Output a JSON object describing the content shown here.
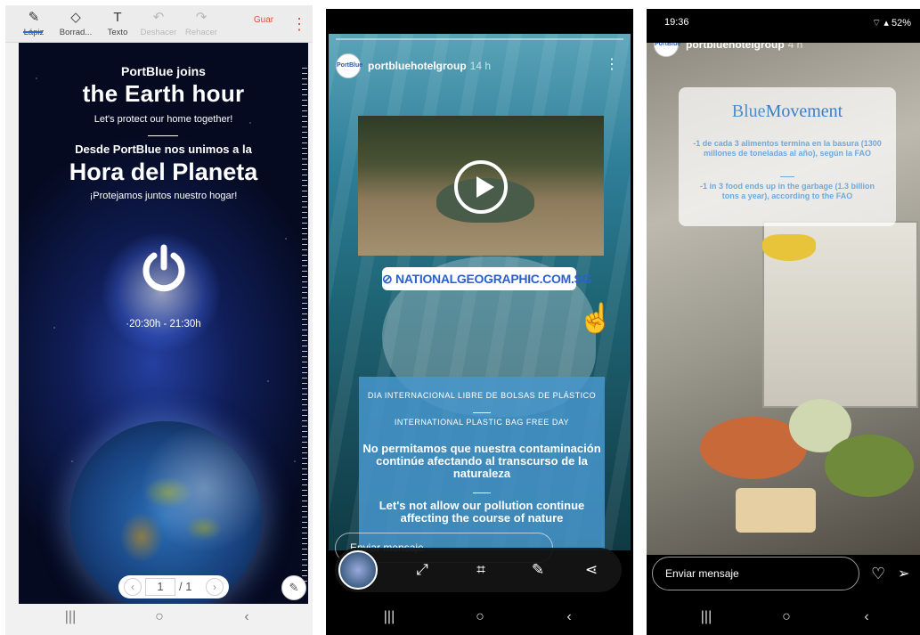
{
  "panel1": {
    "toolbar": {
      "pen_label": "Lápiz",
      "eraser_label": "Borrad...",
      "text_label": "Texto",
      "undo_label": "Deshacer",
      "redo_label": "Rehacer",
      "save_label": "Guar"
    },
    "poster": {
      "line1": "PortBlue joins",
      "line2": "the Earth hour",
      "line3": "Let's protect our home together!",
      "line4": "Desde PortBlue nos unimos a la",
      "line5": "Hora del Planeta",
      "line6": "¡Protejamos juntos nuestro hogar!",
      "time": "·20:30h - 21:30h"
    },
    "pager": {
      "current": "1",
      "total": "/ 1"
    }
  },
  "panel2": {
    "username": "portbluehotelgroup",
    "time_ago": "14 h",
    "avatar_text": "PortBlue",
    "link_text": "NATIONALGEOGRAPHIC.COM.SG",
    "info_es_title": "DIA INTERNACIONAL LIBRE DE BOLSAS DE PLÁSTICO",
    "info_en_title": "INTERNATIONAL PLASTIC BAG FREE DAY",
    "info_es_body": "No permitamos que nuestra contaminación continúe afectando al transcurso de la naturaleza",
    "info_en_body": "Let's not allow our pollution continue affecting the course of nature",
    "message_placeholder": "Enviar mensaje"
  },
  "panel3": {
    "status_time": "19:36",
    "status_battery": "52%",
    "username": "portbluehotelgroup",
    "time_ago": "4 h",
    "avatar_text": "PortBlue",
    "title_part1": "Blue",
    "title_part2": "Movement",
    "text_es": "-1 de cada 3 alimentos termina en la basura (1300 millones de toneladas al año), según la FAO",
    "text_en": "-1 in 3 food ends up in the garbage (1.3 billion tons a year), according to the FAO",
    "message_placeholder": "Enviar mensaje"
  },
  "icons": {
    "pen": "pencil-icon",
    "eraser": "eraser-icon",
    "text": "text-icon",
    "undo": "undo-icon",
    "redo": "redo-icon",
    "power": "power-icon",
    "link": "link-icon"
  },
  "colors": {
    "accent_red": "#e0503c",
    "instagram_link": "#2b5fd0",
    "blue_movement": "#4a8fd0"
  }
}
